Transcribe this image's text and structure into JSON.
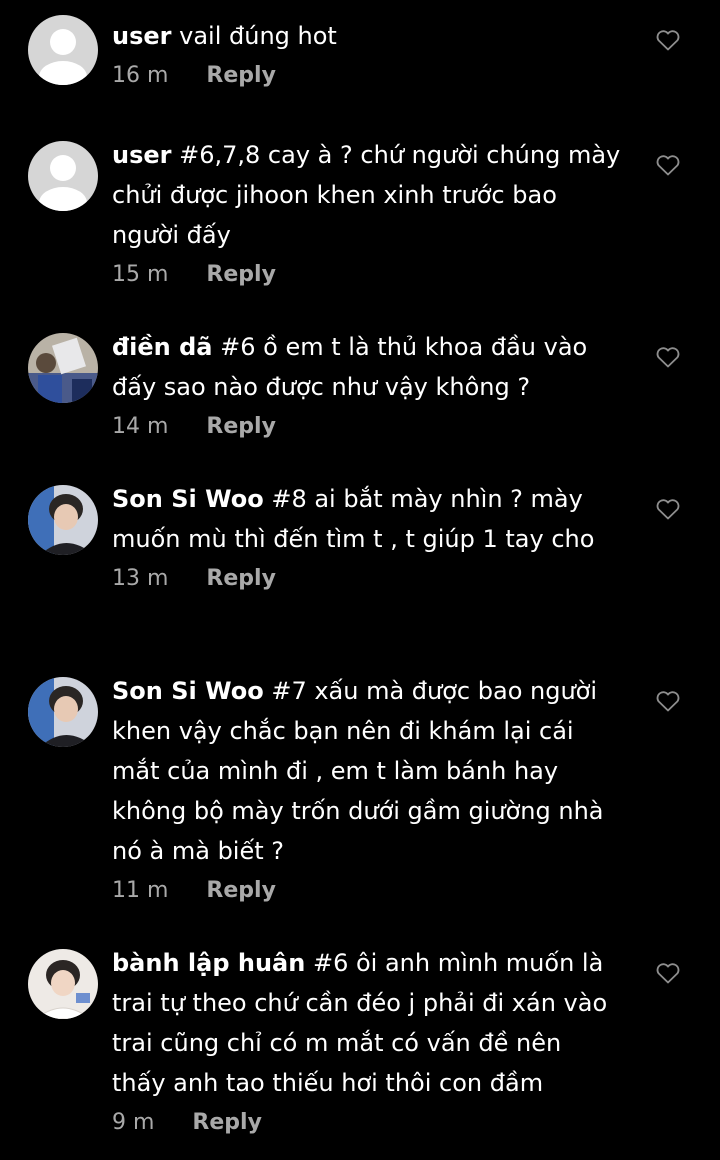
{
  "comments": [
    {
      "username": "user",
      "text": "vail đúng hot",
      "time": "16 m",
      "reply_label": "Reply",
      "avatar_icon": "default-avatar"
    },
    {
      "username": "user",
      "text": "#6,7,8 cay à ? chứ người chúng mày chửi được jihoon khen xinh trước bao người đấy",
      "time": "15 m",
      "reply_label": "Reply",
      "avatar_icon": "default-avatar"
    },
    {
      "username": "điền dã",
      "text": "#6 ồ em t là thủ khoa đầu vào đấy sao nào được như vậy không ?",
      "time": "14 m",
      "reply_label": "Reply",
      "avatar_icon": "photo-avatar"
    },
    {
      "username": "Son Si Woo",
      "text": "#8 ai bắt mày nhìn ? mày muốn mù thì đến tìm t , t giúp 1 tay cho",
      "time": "13 m",
      "reply_label": "Reply",
      "avatar_icon": "photo-avatar"
    },
    {
      "username": "Son Si Woo",
      "text": "#7 xấu mà được bao người khen vậy chắc bạn nên đi khám lại cái mắt của mình đi , em t làm bánh hay không bộ mày trốn dưới gầm giường nhà nó à mà biết ?",
      "time": "11 m",
      "reply_label": "Reply",
      "avatar_icon": "photo-avatar"
    },
    {
      "username": "bành lập huân",
      "text": "#6 ôi anh mình muốn là trai tự theo chứ cần đéo j phải đi xán vào trai cũng chỉ có m mắt có vấn đề nên thấy anh tao thiếu hơi thôi con đầm",
      "time": "9 m",
      "reply_label": "Reply",
      "avatar_icon": "photo-avatar"
    }
  ],
  "colors": {
    "background": "#000000",
    "text": "#ffffff",
    "meta": "#a9a9a9",
    "heart": "#8e8e8e"
  },
  "icons": {
    "like": "heart-outline-icon"
  }
}
